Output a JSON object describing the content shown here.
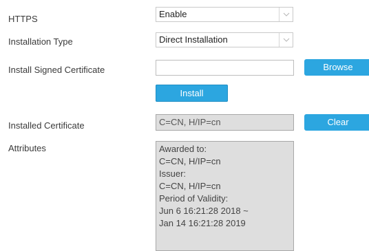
{
  "https": {
    "label": "HTTPS",
    "value": "Enable",
    "dropdown_icon": "chevron-down-icon"
  },
  "installation_type": {
    "label": "Installation Type",
    "value": "Direct Installation",
    "dropdown_icon": "chevron-down-icon"
  },
  "install_signed_certificate": {
    "label": "Install Signed Certificate",
    "value": "",
    "browse_label": "Browse"
  },
  "install_button": {
    "label": "Install"
  },
  "installed_certificate": {
    "label": "Installed Certificate",
    "value": "C=CN, H/IP=cn",
    "clear_label": "Clear"
  },
  "attributes": {
    "label": "Attributes",
    "lines": [
      "Awarded to:",
      "C=CN, H/IP=cn",
      "Issuer:",
      "C=CN, H/IP=cn",
      "Period of Validity:",
      "Jun 6 16:21:28 2018 ~",
      "Jan 14 16:21:28 2019"
    ]
  },
  "colors": {
    "button": "#2ca6e0",
    "readonly_bg": "#dedede"
  }
}
